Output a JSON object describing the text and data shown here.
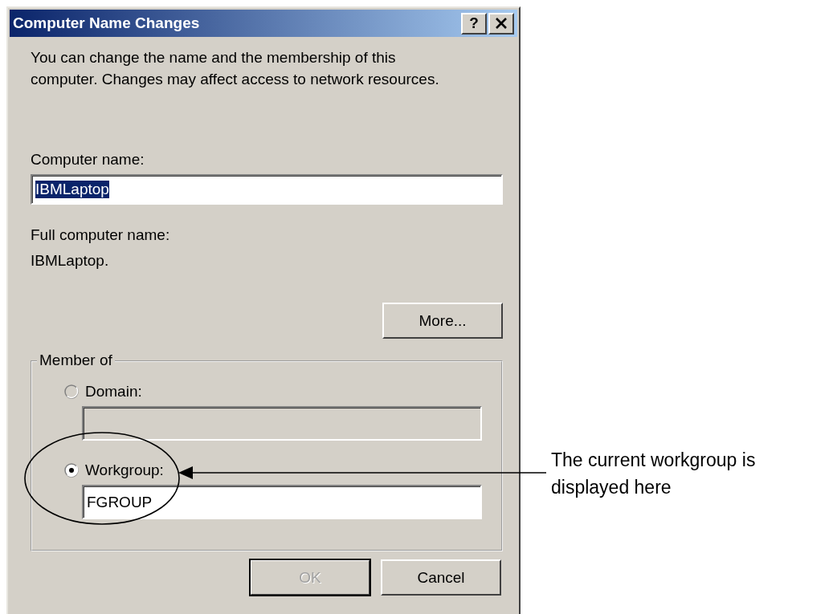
{
  "window": {
    "title": "Computer Name Changes",
    "help_button": "?"
  },
  "intro": "You can change the name and the membership of this computer. Changes may affect access to network resources.",
  "computer_name": {
    "label": "Computer name:",
    "value": "IBMLaptop",
    "value_selected": true
  },
  "full_name": {
    "label": "Full computer name:",
    "value": "IBMLaptop."
  },
  "more_button": "More...",
  "member_of": {
    "title": "Member of",
    "options": [
      {
        "label": "Domain:",
        "selected": false,
        "disabled": true
      },
      {
        "label": "Workgroup:",
        "selected": true,
        "disabled": false,
        "value": "FGROUP"
      }
    ]
  },
  "buttons": [
    {
      "label": "OK",
      "disabled": true,
      "default": true
    },
    {
      "label": "Cancel",
      "disabled": false,
      "default": false
    }
  ],
  "annotation": {
    "text": "The current workgroup is displayed here"
  }
}
